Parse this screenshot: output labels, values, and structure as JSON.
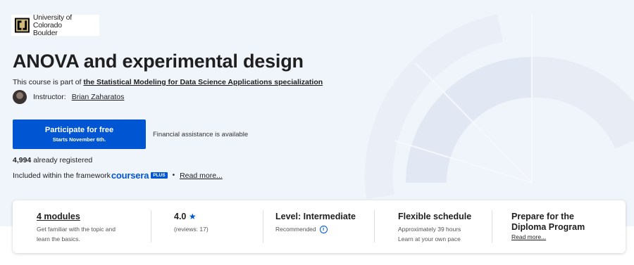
{
  "logo": {
    "line1": "University of Colorado",
    "line2": "Boulder"
  },
  "title": "ANOVA and experimental design",
  "partof": {
    "prefix": "This course is part of ",
    "link": "the Statistical Modeling for Data Science Applications specialization"
  },
  "instructor": {
    "label": "Instructor:",
    "name": "Brian Zaharatos"
  },
  "cta": {
    "label": "Participate for free",
    "sub": "Starts November 6th."
  },
  "financial": "Financial assistance is available",
  "registered": {
    "count": "4,994",
    "suffix": " already registered"
  },
  "included": {
    "prefix": "Included within the framework",
    "brand": "coursera",
    "badge": "PLUS",
    "dot": "•",
    "read_more": "Read more..."
  },
  "stats": {
    "modules": {
      "title": "4 modules",
      "desc_line1": "Get familiar with the topic and",
      "desc_line2": "learn the basics."
    },
    "rating": {
      "value": "4.0",
      "star": "★",
      "reviews": "(reviews: 17)"
    },
    "level": {
      "title": "Level: Intermediate",
      "sub": "Recommended",
      "info": "i"
    },
    "schedule": {
      "title": "Flexible schedule",
      "line1": "Approximately 39 hours",
      "line2": "Learn at your own pace"
    },
    "diploma": {
      "line1": "Prepare for the",
      "line2": "Diploma Program",
      "read_more": "Read more..."
    }
  },
  "colors": {
    "accent": "#0056d2",
    "background": "#f0f4fb"
  }
}
